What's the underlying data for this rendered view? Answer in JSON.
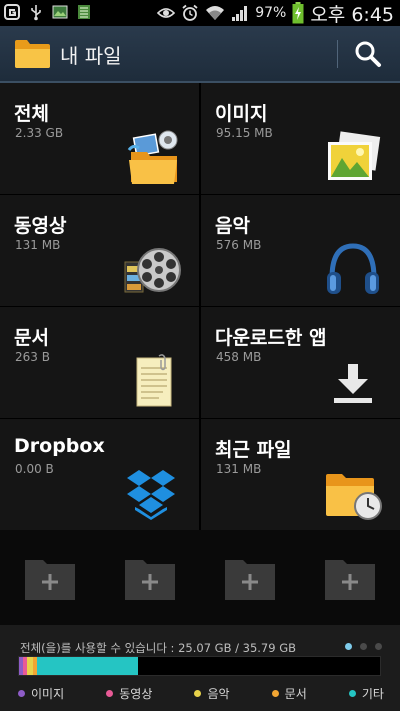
{
  "status_bar": {
    "battery": "97%",
    "time": "오후 6:45",
    "icons": [
      "g-icon",
      "usb-icon",
      "image-icon",
      "sd-icon",
      "eye-icon",
      "alarm-icon",
      "wifi-icon",
      "signal-icon",
      "battery-icon"
    ]
  },
  "header": {
    "title": "내 파일",
    "icons": [
      "folder-icon",
      "search-icon"
    ]
  },
  "categories": [
    {
      "name": "전체",
      "size": "2.33 GB",
      "icon": "all-files-icon"
    },
    {
      "name": "이미지",
      "size": "95.15 MB",
      "icon": "images-icon"
    },
    {
      "name": "동영상",
      "size": "131 MB",
      "icon": "video-reel-icon"
    },
    {
      "name": "음악",
      "size": "576 MB",
      "icon": "headphones-icon"
    },
    {
      "name": "문서",
      "size": "263 B",
      "icon": "document-icon"
    },
    {
      "name": "다운로드한 앱",
      "size": "458 MB",
      "icon": "download-icon"
    },
    {
      "name": "Dropbox",
      "size": "0.00 B",
      "icon": "dropbox-icon"
    },
    {
      "name": "최근 파일",
      "size": "131 MB",
      "icon": "recent-folder-icon"
    }
  ],
  "add_folder_icon": "add-folder-icon",
  "storage": {
    "label": "전체(을)를 사용할 수 있습니다 : 25.07 GB / 35.79 GB",
    "page_count": 3,
    "active_page": 0,
    "segments": [
      {
        "name": "이미지",
        "fraction": 0.012,
        "color": "#8e5cc7"
      },
      {
        "name": "동영상",
        "fraction": 0.01,
        "color": "#e85a96"
      },
      {
        "name": "음악",
        "fraction": 0.016,
        "color": "#e7d24a"
      },
      {
        "name": "문서",
        "fraction": 0.012,
        "color": "#f1a533"
      },
      {
        "name": "기타",
        "fraction": 0.28,
        "color": "#25c5c3"
      }
    ],
    "legend": [
      {
        "label": "이미지",
        "color": "#8e5cc7"
      },
      {
        "label": "동영상",
        "color": "#e85a96"
      },
      {
        "label": "음악",
        "color": "#e7d24a"
      },
      {
        "label": "문서",
        "color": "#f1a533"
      },
      {
        "label": "기타",
        "color": "#25c5c3"
      }
    ]
  }
}
